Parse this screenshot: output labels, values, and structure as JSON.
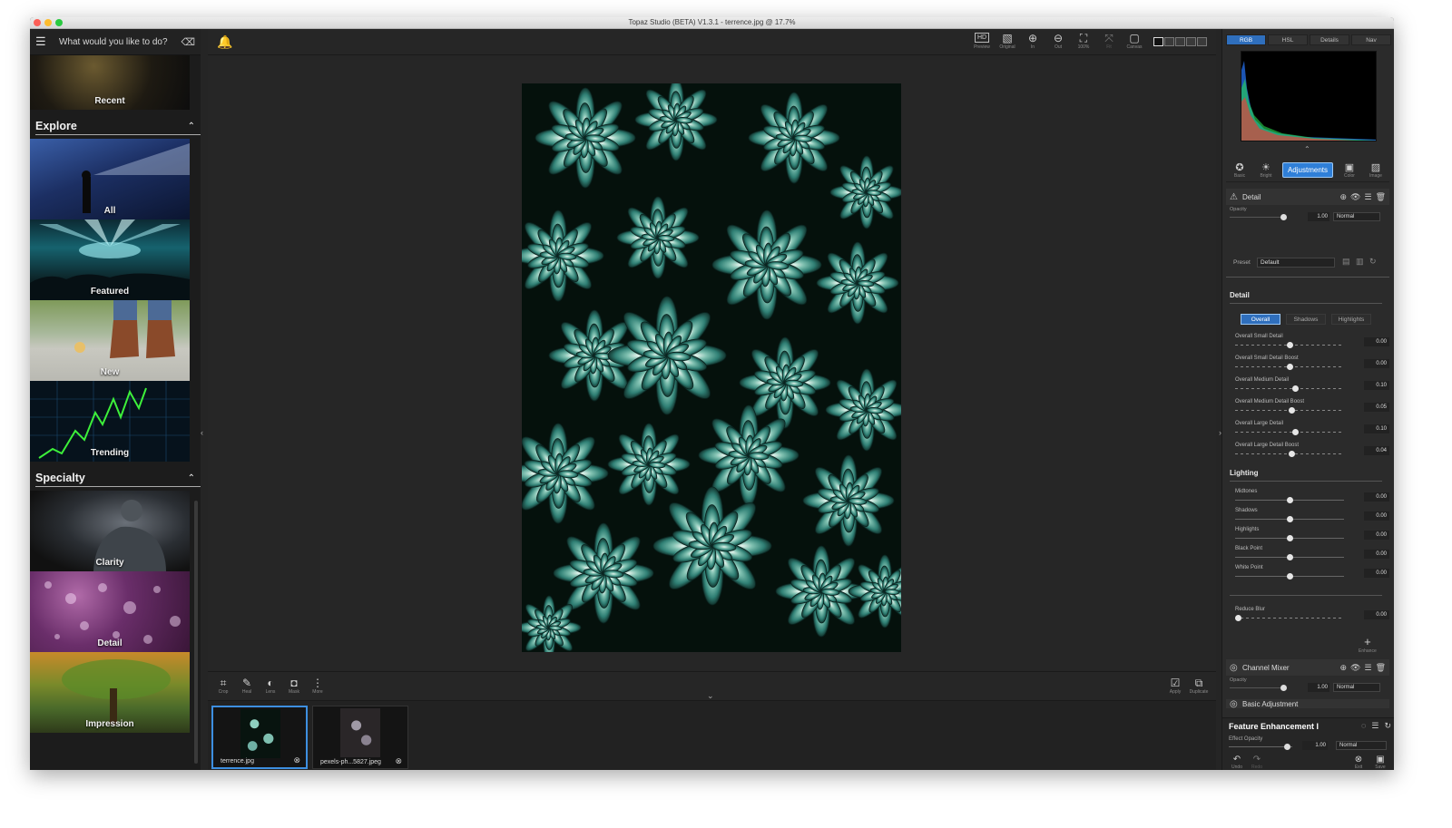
{
  "window": {
    "title": "Topaz Studio (BETA) V1.3.1 - terrence.jpg @ 17.7%",
    "traffic_colors": [
      "#fc5f57",
      "#fdbc2e",
      "#29c940"
    ]
  },
  "sidebar": {
    "prompt": "What would you like to do?",
    "menu_icon": "☰",
    "clear_icon": "⌫",
    "recent_label": "Recent",
    "explore": {
      "title": "Explore",
      "items": [
        {
          "label": "All"
        },
        {
          "label": "Featured"
        },
        {
          "label": "New"
        },
        {
          "label": "Trending"
        }
      ]
    },
    "specialty": {
      "title": "Specialty",
      "items": [
        {
          "label": "Clarity"
        },
        {
          "label": "Detail"
        },
        {
          "label": "Impression"
        }
      ]
    }
  },
  "toolbar": {
    "bell_icon": "🔔",
    "tools": [
      {
        "icon": "HD",
        "label": "Preview"
      },
      {
        "icon": "▧",
        "label": "Original"
      },
      {
        "icon": "⊕",
        "label": "In"
      },
      {
        "icon": "⊖",
        "label": "Out"
      },
      {
        "icon": "⛶",
        "label": "100%"
      },
      {
        "icon": "⤧",
        "label": "Fit"
      },
      {
        "icon": "▢",
        "label": "Canvas"
      }
    ]
  },
  "bottom_tools": {
    "left": [
      {
        "icon": "⌗",
        "label": "Crop"
      },
      {
        "icon": "✎",
        "label": "Heal"
      },
      {
        "icon": "◐",
        "label": "Lens"
      },
      {
        "icon": "◘",
        "label": "Mask"
      },
      {
        "icon": "⋮",
        "label": "More"
      }
    ],
    "right": [
      {
        "icon": "☑",
        "label": "Apply"
      },
      {
        "icon": "⧉",
        "label": "Duplicate"
      }
    ]
  },
  "filmstrip": [
    {
      "name": "terrence.jpg",
      "selected": true
    },
    {
      "name": "pexels-ph...5827.jpeg",
      "selected": false
    }
  ],
  "right_panel": {
    "hist_tabs": [
      "RGB",
      "HSL",
      "Details",
      "Nav"
    ],
    "categories": [
      {
        "icon": "✪",
        "label": "Basic"
      },
      {
        "icon": "☀",
        "label": "Bright"
      },
      {
        "icon": "",
        "label": "Adjustments"
      },
      {
        "icon": "▣",
        "label": "Color"
      },
      {
        "icon": "▨",
        "label": "Image"
      }
    ],
    "detail_layer": {
      "name": "Detail",
      "opacity_label": "Opacity",
      "opacity_value": "1.00",
      "mode": "Normal"
    },
    "preset": {
      "label": "Preset",
      "value": "Default"
    },
    "detail_section": {
      "title": "Detail",
      "tabs": [
        "Overall",
        "Shadows",
        "Highlights"
      ],
      "sliders": [
        {
          "label": "Overall Small Detail",
          "value": "0.00",
          "pos": 0.5
        },
        {
          "label": "Overall Small Detail Boost",
          "value": "0.00",
          "pos": 0.5
        },
        {
          "label": "Overall Medium Detail",
          "value": "0.10",
          "pos": 0.55
        },
        {
          "label": "Overall Medium Detail Boost",
          "value": "0.05",
          "pos": 0.52
        },
        {
          "label": "Overall Large Detail",
          "value": "0.10",
          "pos": 0.55
        },
        {
          "label": "Overall Large Detail Boost",
          "value": "0.04",
          "pos": 0.52
        }
      ]
    },
    "lighting_section": {
      "title": "Lighting",
      "sliders": [
        {
          "label": "Midtones",
          "value": "0.00",
          "pos": 0.5
        },
        {
          "label": "Shadows",
          "value": "0.00",
          "pos": 0.5
        },
        {
          "label": "Highlights",
          "value": "0.00",
          "pos": 0.5
        },
        {
          "label": "Black Point",
          "value": "0.00",
          "pos": 0.5
        },
        {
          "label": "White Point",
          "value": "0.00",
          "pos": 0.5
        }
      ]
    },
    "blur": {
      "label": "Reduce Blur",
      "value": "0.00",
      "pos": 0.0
    },
    "enhance": {
      "icon": "+",
      "label": "Enhance"
    },
    "channel_mixer": {
      "name": "Channel Mixer",
      "opacity_label": "Opacity",
      "opacity_value": "1.00",
      "mode": "Normal"
    },
    "basic_adjustment": {
      "name": "Basic Adjustment"
    },
    "feature": {
      "name": "Feature Enhancement I",
      "opacity_label": "Effect Opacity",
      "opacity_value": "1.00",
      "mode": "Normal",
      "undo": "Undo",
      "redo": "Redo",
      "exit": "Exit",
      "save": "Save"
    }
  }
}
